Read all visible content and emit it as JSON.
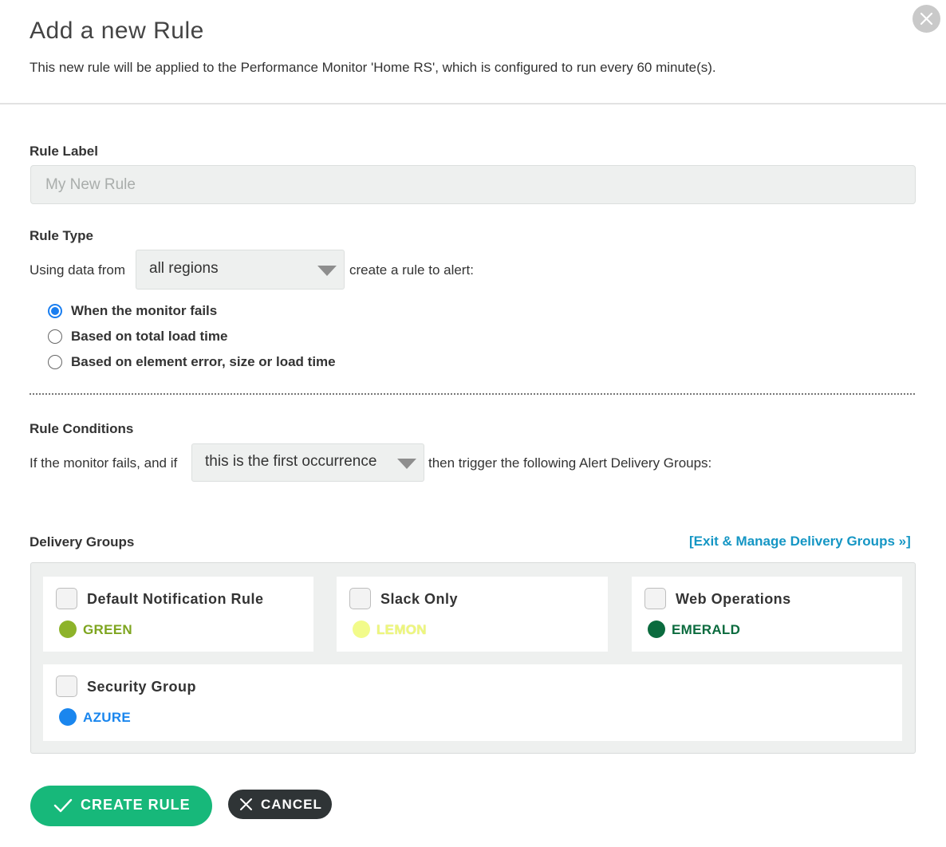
{
  "header": {
    "title": "Add a new Rule",
    "subtitle": "This new rule will be applied to the Performance Monitor 'Home RS', which is configured to run every 60 minute(s).",
    "close_icon": "close-icon"
  },
  "rule_label": {
    "label": "Rule Label",
    "placeholder": "My New Rule",
    "value": ""
  },
  "rule_type": {
    "label": "Rule Type",
    "prefix": "Using data from",
    "region_select": "all regions",
    "suffix": "create a rule to alert:",
    "options": [
      {
        "label": "When the monitor fails",
        "checked": true
      },
      {
        "label": "Based on total load time",
        "checked": false
      },
      {
        "label": "Based on element error, size or load time",
        "checked": false
      }
    ]
  },
  "rule_conditions": {
    "label": "Rule Conditions",
    "prefix": "If the monitor fails, and if",
    "occurrence_select": "this is the first occurrence",
    "suffix": "then trigger the following Alert Delivery Groups:"
  },
  "delivery_groups": {
    "label": "Delivery Groups",
    "manage_link": "[Exit & Manage Delivery Groups »]",
    "groups": [
      {
        "name": "Default Notification Rule",
        "color_name": "GREEN",
        "color": "#8db32a",
        "checked": false
      },
      {
        "name": "Slack Only",
        "color_name": "LEMON",
        "color": "#f2fb8a",
        "checked": false
      },
      {
        "name": "Web Operations",
        "color_name": "EMERALD",
        "color": "#0b6b3e",
        "checked": false
      },
      {
        "name": "Security Group",
        "color_name": "AZURE",
        "color": "#1a86ee",
        "checked": false
      }
    ]
  },
  "actions": {
    "create_label": "CREATE RULE",
    "cancel_label": "CANCEL"
  },
  "colors": {
    "accent_green": "#17b87a",
    "link_blue": "#1596c4",
    "radio_blue": "#1a7ef0",
    "cancel_dark": "#2f3436"
  }
}
